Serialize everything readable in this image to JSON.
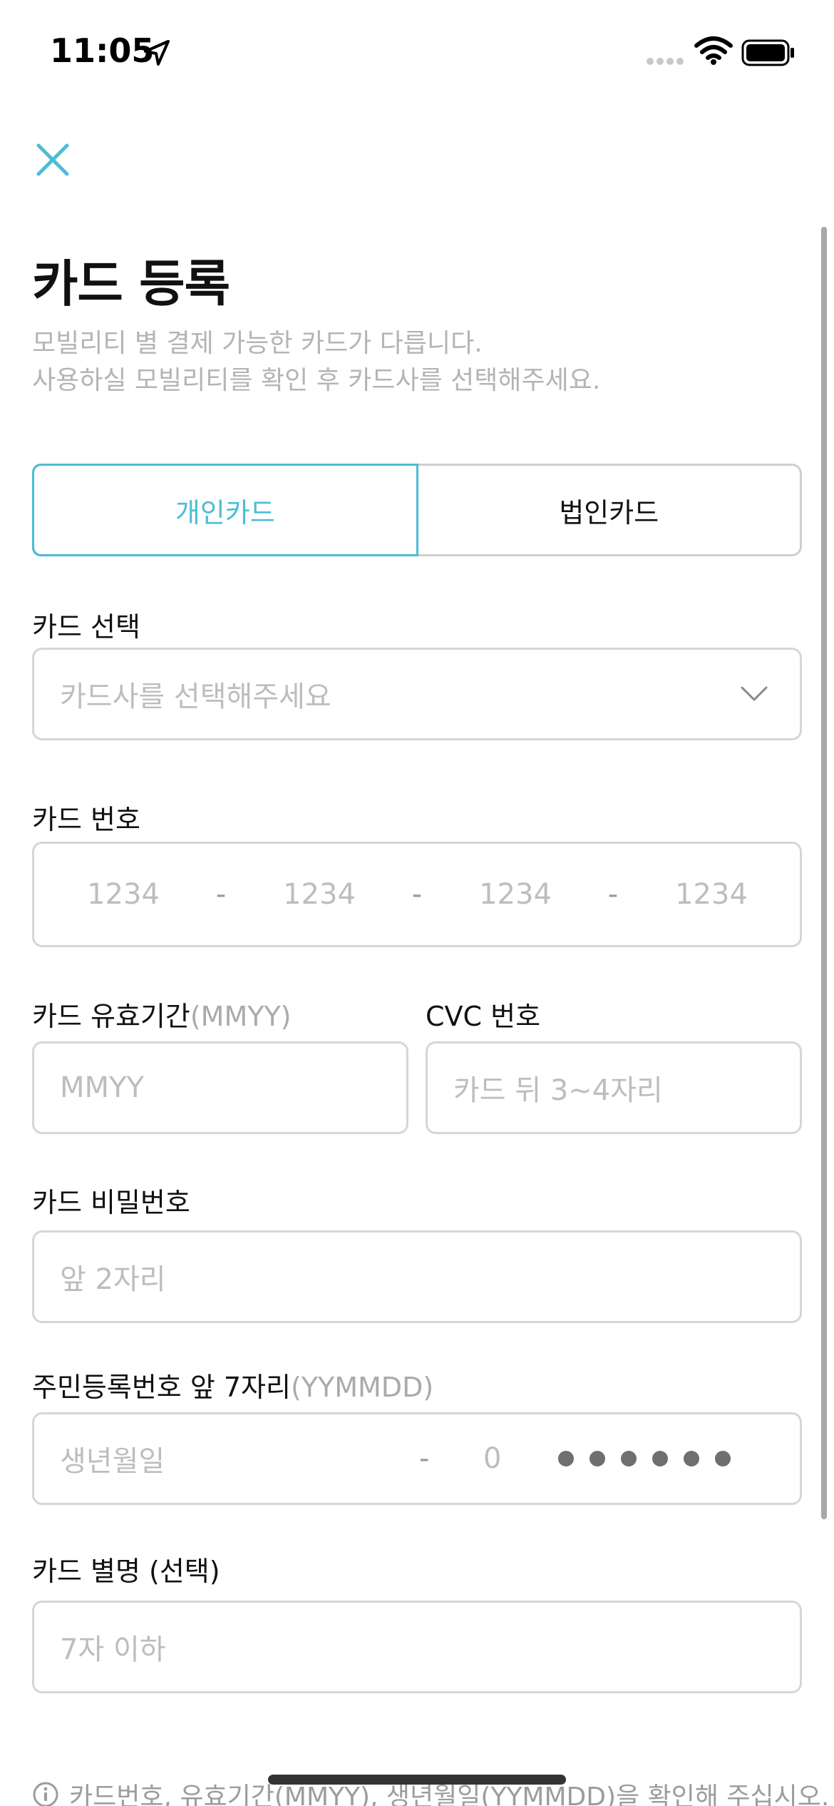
{
  "status_bar": {
    "time": "11:05"
  },
  "header": {
    "title": "카드 등록",
    "description": [
      "모빌리티 별 결제 가능한 카드가 다릅니다.",
      "사용하실 모빌리티를 확인 후 카드사를 선택해주세요."
    ]
  },
  "card_type": {
    "options": [
      "개인카드",
      "법인카드"
    ],
    "selected": "개인카드"
  },
  "card_select": {
    "label": "카드 선택",
    "placeholder": "카드사를 선택해주세요"
  },
  "card_number": {
    "label": "카드 번호",
    "parts": [
      "1234",
      "1234",
      "1234",
      "1234"
    ],
    "separator": "-"
  },
  "expiry": {
    "label": "카드 유효기간",
    "hint": "(MMYY)",
    "placeholder": "MMYY"
  },
  "cvc": {
    "label": "CVC 번호",
    "placeholder": "카드 뒤 3~4자리"
  },
  "password": {
    "label": "카드 비밀번호",
    "placeholder": "앞 2자리"
  },
  "rrn": {
    "label": "주민등록번호 앞 7자리",
    "hint": "(YYMMDD)",
    "placeholder": "생년월일",
    "separator": "-",
    "digit": "0",
    "masked_count": 6
  },
  "nickname": {
    "label": "카드 별명 (선택)",
    "placeholder": "7자 이하"
  },
  "notice": {
    "text": "카드번호, 유효기간(MMYY), 생년월일(YYMMDD)을 확인해 주십시오."
  },
  "colors": {
    "accent": "#4bbdd5",
    "placeholder": "#bdbdbd",
    "border": "#d6d6d6"
  }
}
